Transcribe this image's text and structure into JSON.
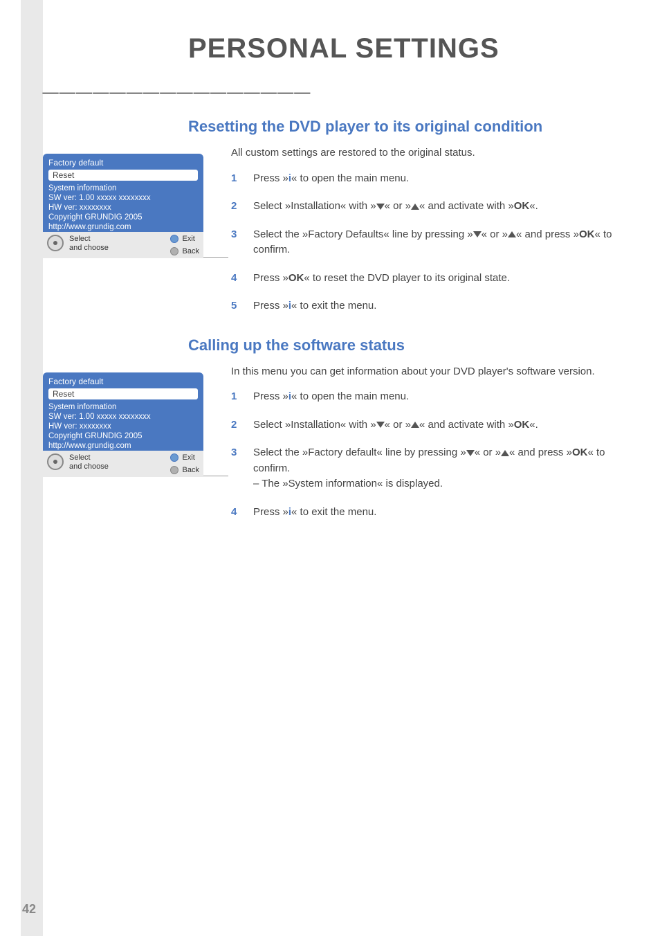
{
  "page": {
    "title": "PERSONAL SETTINGS",
    "title_dashes": "________________",
    "page_number": "42"
  },
  "section1": {
    "heading": "Resetting the DVD player to its original condition",
    "intro": "All custom settings are restored to the original status.",
    "steps": [
      {
        "n": "1",
        "pre": "Press »",
        "icon": "i",
        "post": "« to open the main menu."
      },
      {
        "n": "2",
        "text_parts": [
          "Select »Installation« with »",
          "DOWN",
          "« or »",
          "UP",
          "« and activate with »",
          "OK",
          "«."
        ]
      },
      {
        "n": "3",
        "text_parts": [
          "Select the »Factory Defaults« line by pressing »",
          "DOWN",
          "« or »",
          "UP",
          "« and press »",
          "OK",
          "« to confirm."
        ]
      },
      {
        "n": "4",
        "text_parts": [
          "Press »",
          "OK",
          "« to reset the DVD player to its original state."
        ]
      },
      {
        "n": "5",
        "pre": "Press »",
        "icon": "i",
        "post": "« to exit the menu."
      }
    ]
  },
  "section2": {
    "heading": "Calling up the software status",
    "intro": "In this menu you can get information about your DVD player's software version.",
    "steps": [
      {
        "n": "1",
        "pre": "Press »",
        "icon": "i",
        "post": "« to open the main menu."
      },
      {
        "n": "2",
        "text_parts": [
          "Select »Installation« with »",
          "DOWN",
          "« or »",
          "UP",
          "« and activate with »",
          "OK",
          "«."
        ]
      },
      {
        "n": "3",
        "text_parts": [
          "Select the »Factory default« line by pressing »",
          "DOWN",
          "« or »",
          "UP",
          "« and press »",
          "OK",
          "« to confirm."
        ],
        "sub": "– The »System information« is displayed."
      },
      {
        "n": "4",
        "pre": "Press »",
        "icon": "i",
        "post": "« to exit the menu."
      }
    ]
  },
  "osd": {
    "title": "Factory default",
    "reset": "Reset",
    "lines": [
      "System information",
      "SW ver: 1.00 xxxxx    xxxxxxxx",
      "HW ver: xxxxxxxx",
      "Copyright GRUNDIG 2005",
      "http://www.grundig.com"
    ],
    "footer": {
      "left1": "Select",
      "left2": "and choose",
      "exit": "Exit",
      "back": "Back"
    }
  }
}
